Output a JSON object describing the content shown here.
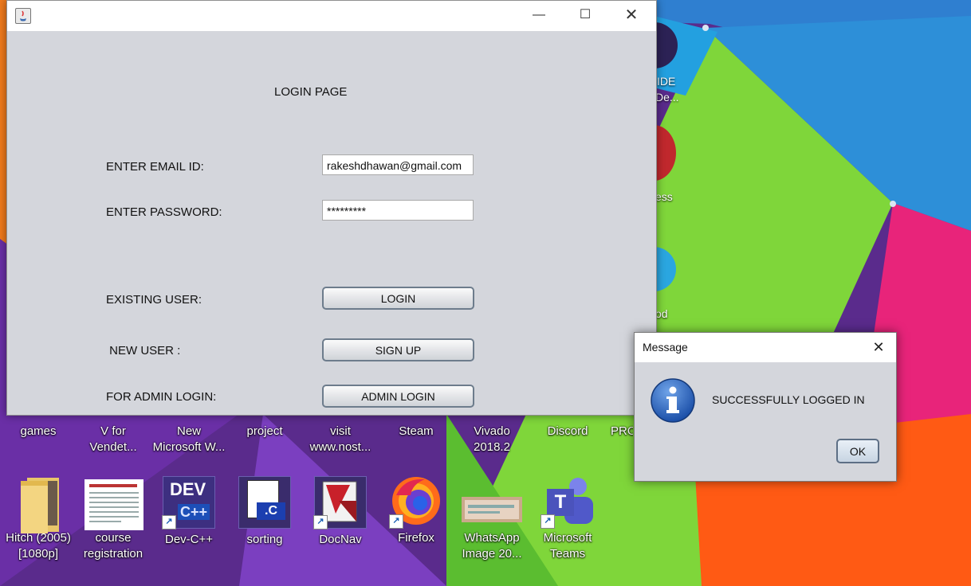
{
  "login_window": {
    "title": "",
    "heading": "LOGIN PAGE",
    "email_label": "ENTER EMAIL ID:",
    "email_value": "rakeshdhawan@gmail.com",
    "password_label": "ENTER PASSWORD:",
    "password_value": "*********",
    "existing_user_label": "EXISTING USER:",
    "login_button": "LOGIN",
    "new_user_label": " NEW USER :",
    "signup_button": "SIGN UP",
    "admin_label": "FOR ADMIN LOGIN:",
    "admin_button": "ADMIN LOGIN",
    "controls": {
      "minimize": "—",
      "maximize": "☐",
      "close": "✕"
    }
  },
  "message_dialog": {
    "title": "Message",
    "close": "✕",
    "icon": "info-icon",
    "text": "SUCCESSFULLY LOGGED IN",
    "ok_button": "OK"
  },
  "desktop": {
    "partial_labels": [
      "IDE",
      "De...",
      "ess",
      "od"
    ],
    "row1": [
      {
        "line1": "games",
        "line2": ""
      },
      {
        "line1": "V for",
        "line2": "Vendet..."
      },
      {
        "line1": "New",
        "line2": "Microsoft W..."
      },
      {
        "line1": "project",
        "line2": ""
      },
      {
        "line1": "visit",
        "line2": "www.nost..."
      },
      {
        "line1": "Steam",
        "line2": ""
      },
      {
        "line1": "Vivado",
        "line2": "2018.2"
      },
      {
        "line1": "Discord",
        "line2": ""
      },
      {
        "line1": "PRO...",
        "line2": ""
      }
    ],
    "row2": [
      {
        "line1": "Hitch (2005)",
        "line2": "[1080p]",
        "icon": "folder-icon"
      },
      {
        "line1": "course",
        "line2": "registration",
        "icon": "document-icon"
      },
      {
        "line1": "Dev-C++",
        "line2": "",
        "icon": "devcpp-icon"
      },
      {
        "line1": "sorting",
        "line2": "",
        "icon": "c-source-file-icon"
      },
      {
        "line1": "DocNav",
        "line2": "",
        "icon": "docnav-icon"
      },
      {
        "line1": "Firefox",
        "line2": "",
        "icon": "firefox-icon"
      },
      {
        "line1": "WhatsApp",
        "line2": "Image 20...",
        "icon": "image-file-icon"
      },
      {
        "line1": "Microsoft",
        "line2": "Teams",
        "icon": "teams-icon"
      }
    ],
    "icon_text": {
      "dev": "DEV",
      "cpp": "C++",
      "c_ext": ".C",
      "teams": "T"
    }
  }
}
